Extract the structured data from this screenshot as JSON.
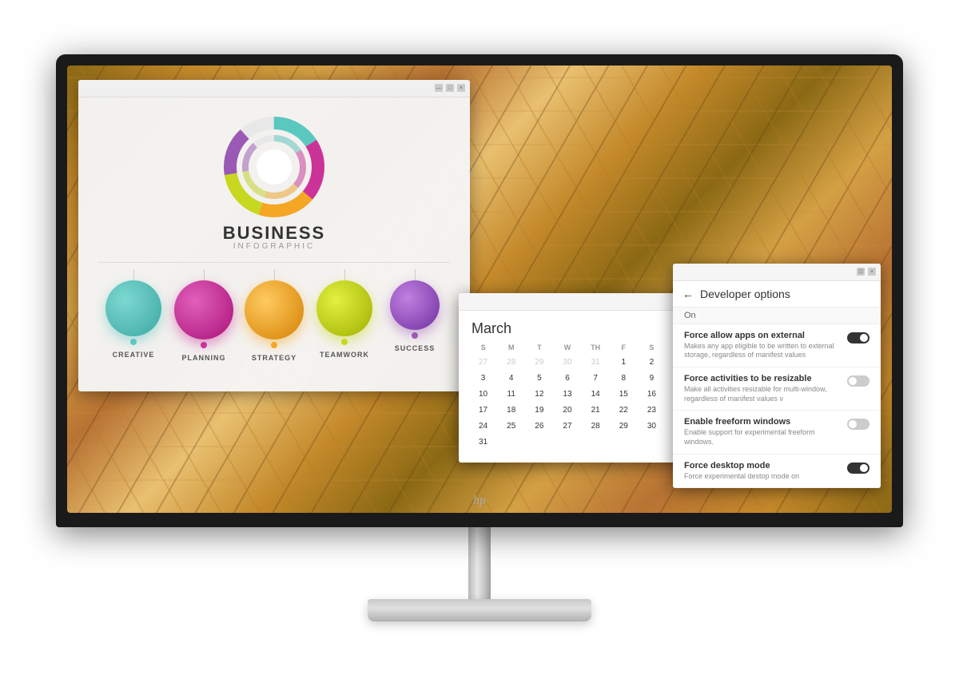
{
  "monitor": {
    "brand": "hp",
    "logo_symbol": "𝓱𝓹"
  },
  "infographic_panel": {
    "title": "BUSINESS",
    "subtitle": "INFOGRAPHIC",
    "circles": [
      {
        "label": "CREATIVE",
        "color": "#5BC8C0",
        "dot_color": "#5BC8C0",
        "size": 68
      },
      {
        "label": "PLANNING",
        "color": "#CC3399",
        "dot_color": "#CC3399",
        "size": 72
      },
      {
        "label": "STRATEGY",
        "color": "#F5A623",
        "dot_color": "#F5A623",
        "size": 72
      },
      {
        "label": "TEAMWORK",
        "color": "#C8D820",
        "dot_color": "#C8D820",
        "size": 68
      },
      {
        "label": "SUCCESS",
        "color": "#9B59B6",
        "dot_color": "#9B59B6",
        "size": 60
      }
    ]
  },
  "calendar": {
    "month": "March",
    "days_header": [
      "S",
      "M",
      "T",
      "W",
      "TH",
      "F",
      "S"
    ],
    "weeks": [
      [
        "27",
        "28",
        "29",
        "30",
        "31",
        "1",
        "2"
      ],
      [
        "3",
        "4",
        "5",
        "6",
        "7",
        "8",
        "9"
      ],
      [
        "10",
        "11",
        "12",
        "13",
        "14",
        "15",
        "16"
      ],
      [
        "17",
        "18",
        "19",
        "20",
        "21",
        "22",
        "23"
      ],
      [
        "24",
        "25",
        "26",
        "27",
        "28",
        "29",
        "30"
      ],
      [
        "31",
        "",
        "",
        "",
        "",
        "",
        ""
      ]
    ],
    "empty_prev": [
      "27",
      "28",
      "29",
      "30",
      "31"
    ]
  },
  "developer_options": {
    "title": "Developer options",
    "back_icon": "←",
    "on_label": "On",
    "items": [
      {
        "title": "Force allow apps on external",
        "description": "Makes any app eligible to be written to external storage, regardless of manifest values",
        "toggle": "on"
      },
      {
        "title": "Force activities to be resizable",
        "description": "Make all activities resizable for multi-window, regardless of manifest values v",
        "toggle": "off"
      },
      {
        "title": "Enable freeform windows",
        "description": "Enable support for experimental freeform windows.",
        "toggle": "off"
      },
      {
        "title": "Force desktop mode",
        "description": "Force experimental destop mode on",
        "toggle": "on"
      }
    ]
  }
}
